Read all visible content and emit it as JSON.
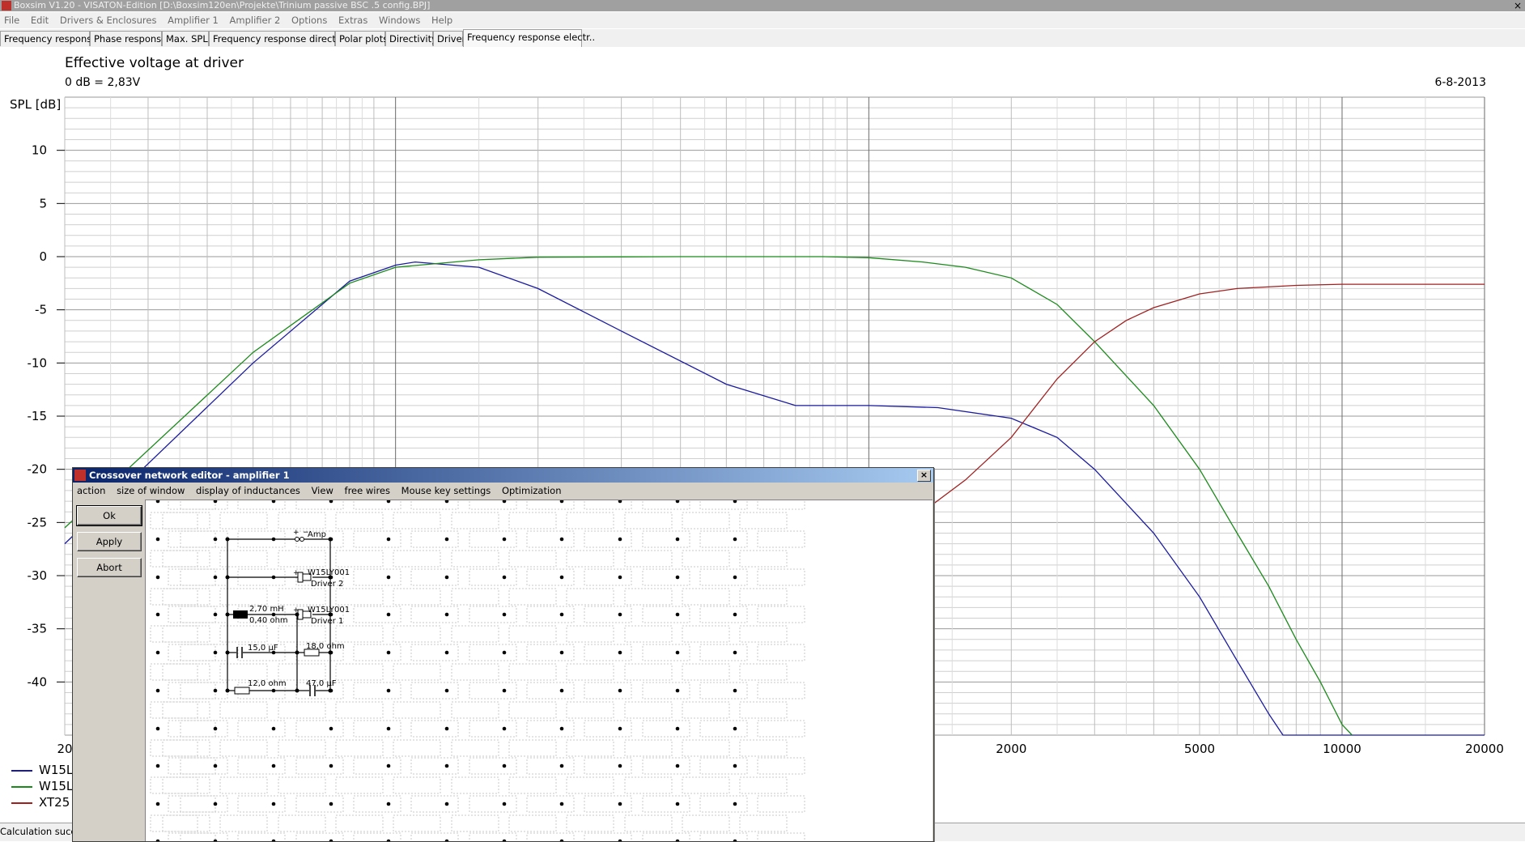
{
  "window": {
    "title": "Boxsim V1.20 - VISATON-Edition [D:\\Boxsim120en\\Projekte\\Trinium passive BSC .5 config.BPJ]",
    "close": "×"
  },
  "menubar": [
    "File",
    "Edit",
    "Drivers & Enclosures",
    "Amplifier 1",
    "Amplifier 2",
    "Options",
    "Extras",
    "Windows",
    "Help"
  ],
  "tabs": [
    {
      "label": "Frequency response.",
      "left": 0,
      "width": 109
    },
    {
      "label": "Phase response",
      "left": 111,
      "width": 87
    },
    {
      "label": "Max. SPL",
      "left": 200,
      "width": 56
    },
    {
      "label": "Frequency response directions",
      "left": 258,
      "width": 154
    },
    {
      "label": "Polar plots",
      "left": 414,
      "width": 60
    },
    {
      "label": "Directivity",
      "left": 476,
      "width": 57
    },
    {
      "label": "Driver",
      "left": 535,
      "width": 35
    },
    {
      "label": "Frequency response electr..",
      "left": 572,
      "width": 145
    }
  ],
  "chart": {
    "title": "Effective voltage at driver",
    "subtitle": "0 dB = 2,83V",
    "date": "6-8-2013",
    "ylabel": "SPL [dB]"
  },
  "chart_data": {
    "type": "line",
    "title": "Effective voltage at driver",
    "xlabel": "",
    "ylabel": "SPL [dB]",
    "xscale": "log",
    "xlim": [
      20,
      20000
    ],
    "ylim": [
      -45,
      15
    ],
    "y_ticks": [
      10,
      5,
      0,
      -5,
      -10,
      -15,
      -20,
      -25,
      -30,
      -35,
      -40
    ],
    "x_ticks": [
      20,
      2000,
      5000,
      10000,
      20000
    ],
    "grid": true,
    "legend": "bottom-left",
    "series": [
      {
        "name": "W15L",
        "color": "#1a1aa0",
        "points": [
          [
            20,
            -27
          ],
          [
            50,
            -10
          ],
          [
            80,
            -2.3
          ],
          [
            100,
            -0.8
          ],
          [
            110,
            -0.5
          ],
          [
            150,
            -1
          ],
          [
            200,
            -3
          ],
          [
            300,
            -7
          ],
          [
            500,
            -12
          ],
          [
            700,
            -14
          ],
          [
            1000,
            -14
          ],
          [
            1400,
            -14.2
          ],
          [
            2000,
            -15.2
          ],
          [
            2500,
            -17
          ],
          [
            3000,
            -20
          ],
          [
            4000,
            -26
          ],
          [
            5000,
            -32
          ],
          [
            6000,
            -38
          ],
          [
            7000,
            -43
          ],
          [
            7500,
            -45
          ],
          [
            20000,
            -45
          ]
        ]
      },
      {
        "name": "W15L",
        "color": "#1a8a1a",
        "points": [
          [
            20,
            -25.5
          ],
          [
            50,
            -9
          ],
          [
            80,
            -2.5
          ],
          [
            100,
            -1
          ],
          [
            150,
            -0.3
          ],
          [
            200,
            -0.05
          ],
          [
            400,
            0
          ],
          [
            800,
            0
          ],
          [
            1000,
            -0.1
          ],
          [
            1300,
            -0.5
          ],
          [
            1600,
            -1
          ],
          [
            2000,
            -2
          ],
          [
            2500,
            -4.5
          ],
          [
            3000,
            -8
          ],
          [
            4000,
            -14
          ],
          [
            5000,
            -20
          ],
          [
            6000,
            -26
          ],
          [
            7000,
            -31
          ],
          [
            8000,
            -36
          ],
          [
            9000,
            -40
          ],
          [
            10000,
            -44
          ],
          [
            10500,
            -45
          ]
        ]
      },
      {
        "name": "XT25",
        "color": "#a02020",
        "points": [
          [
            1000,
            -29
          ],
          [
            1300,
            -24
          ],
          [
            1600,
            -21
          ],
          [
            2000,
            -17
          ],
          [
            2500,
            -11.5
          ],
          [
            3000,
            -8
          ],
          [
            3500,
            -6
          ],
          [
            4000,
            -4.8
          ],
          [
            5000,
            -3.5
          ],
          [
            6000,
            -3
          ],
          [
            8000,
            -2.7
          ],
          [
            10000,
            -2.6
          ],
          [
            20000,
            -2.6
          ]
        ]
      }
    ]
  },
  "legend": [
    {
      "label": "W15L",
      "color": "#1a1aa0"
    },
    {
      "label": "W15L",
      "color": "#1a8a1a"
    },
    {
      "label": "XT25",
      "color": "#a02020"
    }
  ],
  "status": "Calculation succes",
  "dialog": {
    "title": "Crossover network editor - amplifier 1",
    "menu": [
      "action",
      "size of window",
      "display of inductances",
      "View",
      "free wires",
      "Mouse key settings",
      "Optimization"
    ],
    "buttons": {
      "ok": "Ok",
      "apply": "Apply",
      "abort": "Abort"
    },
    "circuit": {
      "amp": "Amp",
      "driver2_model": "W15LY001",
      "driver2_name": "Driver 2",
      "driver1_model": "W15LY001",
      "driver1_name": "Driver 1",
      "coil_value": "2,70 mH",
      "coil_res": "0,40 ohm",
      "cap1": "15,0 µF",
      "res1": "18,0 ohm",
      "res2": "12,0 ohm",
      "cap2": "47,0 µF"
    }
  }
}
